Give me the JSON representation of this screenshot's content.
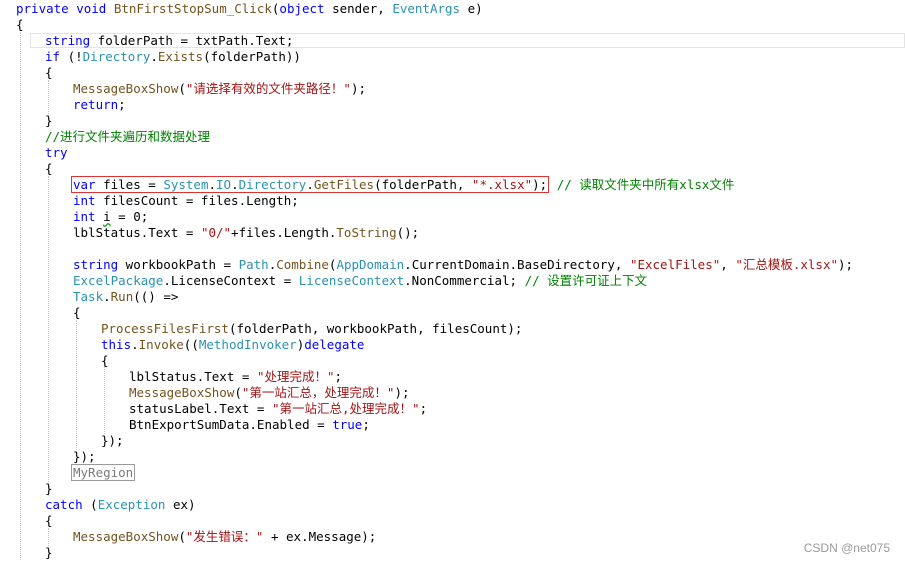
{
  "code_lines": [
    {
      "segments": [
        {
          "t": "private void ",
          "c": "kw"
        },
        {
          "t": "BtnFirstStopSum_Click",
          "c": "mt"
        },
        {
          "t": "(",
          "c": ""
        },
        {
          "t": "object",
          "c": "kw"
        },
        {
          "t": " sender, ",
          "c": ""
        },
        {
          "t": "EventArgs",
          "c": "ty"
        },
        {
          "t": " e)",
          "c": ""
        }
      ]
    },
    {
      "segments": [
        {
          "t": "{",
          "c": ""
        }
      ]
    },
    {
      "segments": [
        {
          "t": "string",
          "c": "kw"
        },
        {
          "t": " folderPath = txtPath.Text;",
          "c": ""
        }
      ]
    },
    {
      "segments": [
        {
          "t": "if",
          "c": "kw"
        },
        {
          "t": " (!",
          "c": ""
        },
        {
          "t": "Directory",
          "c": "ty"
        },
        {
          "t": ".",
          "c": ""
        },
        {
          "t": "Exists",
          "c": "mt"
        },
        {
          "t": "(folderPath))",
          "c": ""
        }
      ]
    },
    {
      "segments": [
        {
          "t": "{",
          "c": ""
        }
      ]
    },
    {
      "segments": [
        {
          "t": "MessageBoxShow",
          "c": "mt"
        },
        {
          "t": "(",
          "c": ""
        },
        {
          "t": "\"请选择有效的文件夹路径！\"",
          "c": "str"
        },
        {
          "t": ");",
          "c": ""
        }
      ]
    },
    {
      "segments": [
        {
          "t": "return",
          "c": "kw"
        },
        {
          "t": ";",
          "c": ""
        }
      ]
    },
    {
      "segments": [
        {
          "t": "}",
          "c": ""
        }
      ]
    },
    {
      "segments": [
        {
          "t": "//进行文件夹遍历和数据处理",
          "c": "cm"
        }
      ]
    },
    {
      "segments": [
        {
          "t": "try",
          "c": "kw"
        }
      ]
    },
    {
      "segments": [
        {
          "t": "{",
          "c": ""
        }
      ]
    },
    {
      "segments": [
        {
          "t": "var",
          "c": "kw"
        },
        {
          "t": " files = ",
          "c": ""
        },
        {
          "t": "System",
          "c": "ty"
        },
        {
          "t": ".",
          "c": ""
        },
        {
          "t": "IO",
          "c": "ty"
        },
        {
          "t": ".",
          "c": ""
        },
        {
          "t": "Directory",
          "c": "ty"
        },
        {
          "t": ".",
          "c": ""
        },
        {
          "t": "GetFiles",
          "c": "mt"
        },
        {
          "t": "(folderPath, ",
          "c": ""
        },
        {
          "t": "\"*.xlsx\"",
          "c": "str"
        },
        {
          "t": ");",
          "c": ""
        }
      ],
      "trail": {
        "t": " // 读取文件夹中所有xlsx文件",
        "c": "cm"
      }
    },
    {
      "segments": [
        {
          "t": "int",
          "c": "kw"
        },
        {
          "t": " filesCount = files.Length;",
          "c": ""
        }
      ]
    },
    {
      "segments": [
        {
          "t": "int",
          "c": "kw"
        },
        {
          "t": " ",
          "c": ""
        },
        {
          "t": "i",
          "c": "sq"
        },
        {
          "t": " = 0;",
          "c": ""
        }
      ]
    },
    {
      "segments": [
        {
          "t": "lblStatus.Text = ",
          "c": ""
        },
        {
          "t": "\"0/\"",
          "c": "str"
        },
        {
          "t": "+files.Length.",
          "c": ""
        },
        {
          "t": "ToString",
          "c": "mt"
        },
        {
          "t": "();",
          "c": ""
        }
      ]
    },
    {
      "segments": []
    },
    {
      "segments": [
        {
          "t": "string",
          "c": "kw"
        },
        {
          "t": " workbookPath = ",
          "c": ""
        },
        {
          "t": "Path",
          "c": "ty"
        },
        {
          "t": ".",
          "c": ""
        },
        {
          "t": "Combine",
          "c": "mt"
        },
        {
          "t": "(",
          "c": ""
        },
        {
          "t": "AppDomain",
          "c": "ty"
        },
        {
          "t": ".CurrentDomain.BaseDirectory, ",
          "c": ""
        },
        {
          "t": "\"ExcelFiles\"",
          "c": "str"
        },
        {
          "t": ", ",
          "c": ""
        },
        {
          "t": "\"汇总模板.xlsx\"",
          "c": "str"
        },
        {
          "t": ");",
          "c": ""
        }
      ]
    },
    {
      "segments": [
        {
          "t": "ExcelPackage",
          "c": "ty"
        },
        {
          "t": ".LicenseContext = ",
          "c": ""
        },
        {
          "t": "LicenseContext",
          "c": "ty"
        },
        {
          "t": ".NonCommercial; ",
          "c": ""
        },
        {
          "t": "// 设置许可证上下文",
          "c": "cm"
        }
      ]
    },
    {
      "segments": [
        {
          "t": "Task",
          "c": "ty"
        },
        {
          "t": ".",
          "c": ""
        },
        {
          "t": "Run",
          "c": "mt"
        },
        {
          "t": "(() =>",
          "c": ""
        }
      ]
    },
    {
      "segments": [
        {
          "t": "{",
          "c": ""
        }
      ]
    },
    {
      "segments": [
        {
          "t": "ProcessFilesFirst",
          "c": "mt"
        },
        {
          "t": "(folderPath, workbookPath, filesCount);",
          "c": ""
        }
      ]
    },
    {
      "segments": [
        {
          "t": "this",
          "c": "kw"
        },
        {
          "t": ".",
          "c": ""
        },
        {
          "t": "Invoke",
          "c": "mt"
        },
        {
          "t": "((",
          "c": ""
        },
        {
          "t": "MethodInvoker",
          "c": "ty"
        },
        {
          "t": ")",
          "c": ""
        },
        {
          "t": "delegate",
          "c": "kw"
        }
      ]
    },
    {
      "segments": [
        {
          "t": "{",
          "c": ""
        }
      ]
    },
    {
      "segments": [
        {
          "t": "lblStatus.Text = ",
          "c": ""
        },
        {
          "t": "\"处理完成！\"",
          "c": "str"
        },
        {
          "t": ";",
          "c": ""
        }
      ]
    },
    {
      "segments": [
        {
          "t": "MessageBoxShow",
          "c": "mt"
        },
        {
          "t": "(",
          "c": ""
        },
        {
          "t": "\"第一站汇总，处理完成！\"",
          "c": "str"
        },
        {
          "t": ");",
          "c": ""
        }
      ]
    },
    {
      "segments": [
        {
          "t": "statusLabel.Text = ",
          "c": ""
        },
        {
          "t": "\"第一站汇总,处理完成！\"",
          "c": "str"
        },
        {
          "t": ";",
          "c": ""
        }
      ]
    },
    {
      "segments": [
        {
          "t": "BtnExportSumData.Enabled = ",
          "c": ""
        },
        {
          "t": "true",
          "c": "kw"
        },
        {
          "t": ";",
          "c": ""
        }
      ]
    },
    {
      "segments": [
        {
          "t": "});",
          "c": ""
        }
      ]
    },
    {
      "segments": [
        {
          "t": "});",
          "c": ""
        }
      ]
    },
    {
      "segments": [
        {
          "t": "MyRegion",
          "c": "region"
        }
      ]
    },
    {
      "segments": [
        {
          "t": "}",
          "c": ""
        }
      ]
    },
    {
      "segments": [
        {
          "t": "catch",
          "c": "kw"
        },
        {
          "t": " (",
          "c": ""
        },
        {
          "t": "Exception",
          "c": "ty"
        },
        {
          "t": " ex)",
          "c": ""
        }
      ]
    },
    {
      "segments": [
        {
          "t": "{",
          "c": ""
        }
      ]
    },
    {
      "segments": [
        {
          "t": "MessageBoxShow",
          "c": "mt"
        },
        {
          "t": "(",
          "c": ""
        },
        {
          "t": "\"发生错误：\"",
          "c": "str"
        },
        {
          "t": " + ex.Message);",
          "c": ""
        }
      ]
    },
    {
      "segments": [
        {
          "t": "}",
          "c": ""
        }
      ]
    }
  ],
  "watermark": "CSDN @net075"
}
